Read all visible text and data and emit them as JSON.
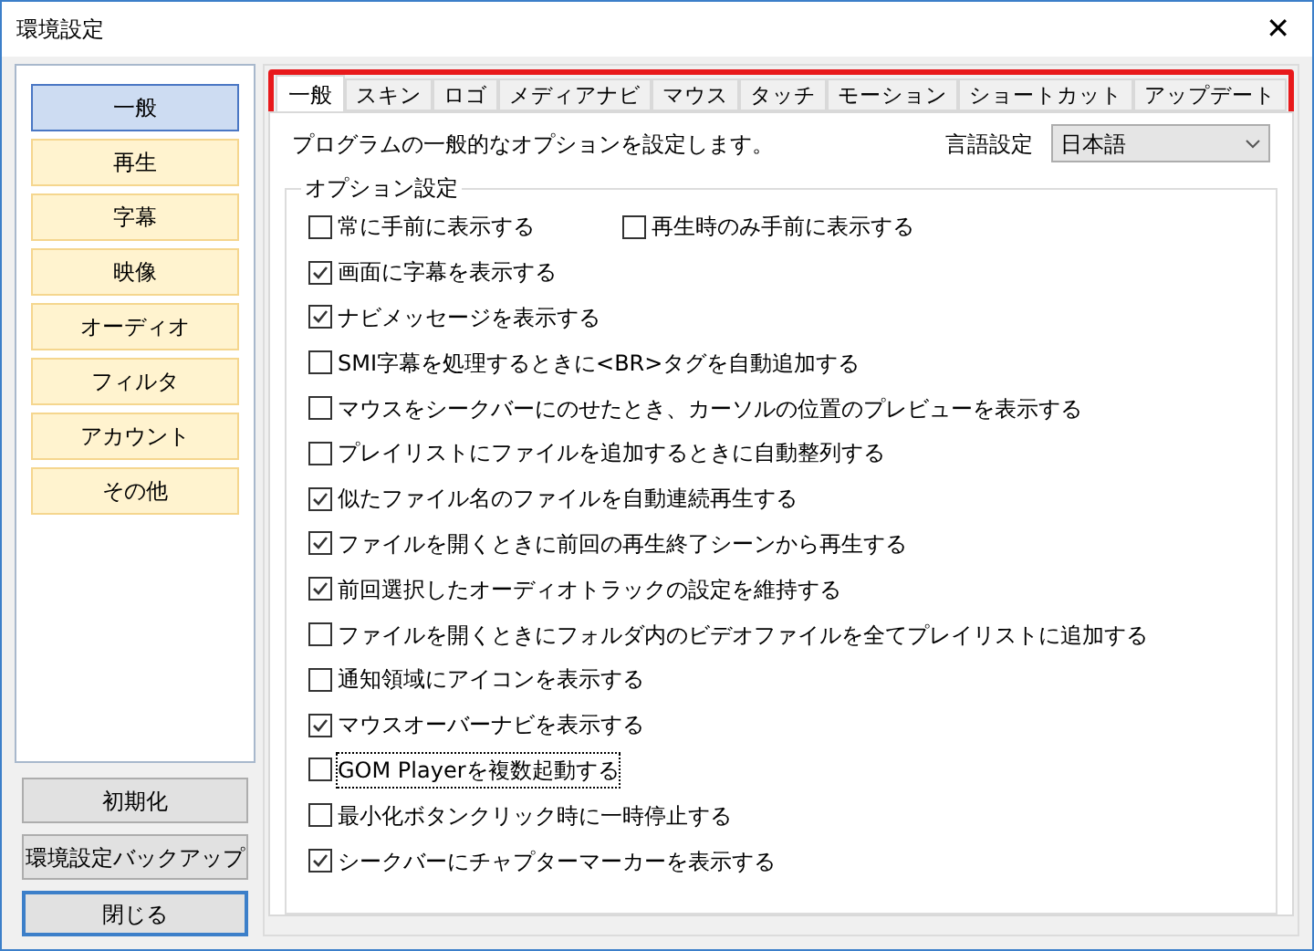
{
  "window": {
    "title": "環境設定",
    "close": "✕"
  },
  "sidebar": {
    "items": [
      {
        "label": "一般",
        "selected": true
      },
      {
        "label": "再生",
        "selected": false
      },
      {
        "label": "字幕",
        "selected": false
      },
      {
        "label": "映像",
        "selected": false
      },
      {
        "label": "オーディオ",
        "selected": false
      },
      {
        "label": "フィルタ",
        "selected": false
      },
      {
        "label": "アカウント",
        "selected": false
      },
      {
        "label": "その他",
        "selected": false
      }
    ],
    "buttons": [
      {
        "label": "初期化",
        "default": false
      },
      {
        "label": "環境設定バックアップ",
        "default": false
      },
      {
        "label": "閉じる",
        "default": true
      }
    ]
  },
  "tabs_highlighted": true,
  "tabs": [
    {
      "label": "一般",
      "selected": true
    },
    {
      "label": "スキン",
      "selected": false
    },
    {
      "label": "ロゴ",
      "selected": false
    },
    {
      "label": "メディアナビ",
      "selected": false
    },
    {
      "label": "マウス",
      "selected": false
    },
    {
      "label": "タッチ",
      "selected": false
    },
    {
      "label": "モーション",
      "selected": false
    },
    {
      "label": "ショートカット",
      "selected": false
    },
    {
      "label": "アップデート",
      "selected": false
    }
  ],
  "description": "プログラムの一般的なオプションを設定します。",
  "language": {
    "label": "言語設定",
    "value": "日本語"
  },
  "options_group": {
    "title": "オプション設定",
    "rows": [
      [
        {
          "label": "常に手前に表示する",
          "checked": false,
          "focused": false
        },
        {
          "label": "再生時のみ手前に表示する",
          "checked": false,
          "focused": false
        }
      ],
      [
        {
          "label": "画面に字幕を表示する",
          "checked": true,
          "focused": false
        }
      ],
      [
        {
          "label": "ナビメッセージを表示する",
          "checked": true,
          "focused": false
        }
      ],
      [
        {
          "label": "SMI字幕を処理するときに<BR>タグを自動追加する",
          "checked": false,
          "focused": false
        }
      ],
      [
        {
          "label": "マウスをシークバーにのせたとき、カーソルの位置のプレビューを表示する",
          "checked": false,
          "focused": false
        }
      ],
      [
        {
          "label": "プレイリストにファイルを追加するときに自動整列する",
          "checked": false,
          "focused": false
        }
      ],
      [
        {
          "label": "似たファイル名のファイルを自動連続再生する",
          "checked": true,
          "focused": false
        }
      ],
      [
        {
          "label": "ファイルを開くときに前回の再生終了シーンから再生する",
          "checked": true,
          "focused": false
        }
      ],
      [
        {
          "label": "前回選択したオーディオトラックの設定を維持する",
          "checked": true,
          "focused": false
        }
      ],
      [
        {
          "label": "ファイルを開くときにフォルダ内のビデオファイルを全てプレイリストに追加する",
          "checked": false,
          "focused": false
        }
      ],
      [
        {
          "label": "通知領域にアイコンを表示する",
          "checked": false,
          "focused": false
        }
      ],
      [
        {
          "label": "マウスオーバーナビを表示する",
          "checked": true,
          "focused": false
        }
      ],
      [
        {
          "label": "GOM Playerを複数起動する",
          "checked": false,
          "focused": true
        }
      ],
      [
        {
          "label": "最小化ボタンクリック時に一時停止する",
          "checked": false,
          "focused": false
        }
      ],
      [
        {
          "label": "シークバーにチャプターマーカーを表示する",
          "checked": true,
          "focused": false
        }
      ]
    ]
  }
}
